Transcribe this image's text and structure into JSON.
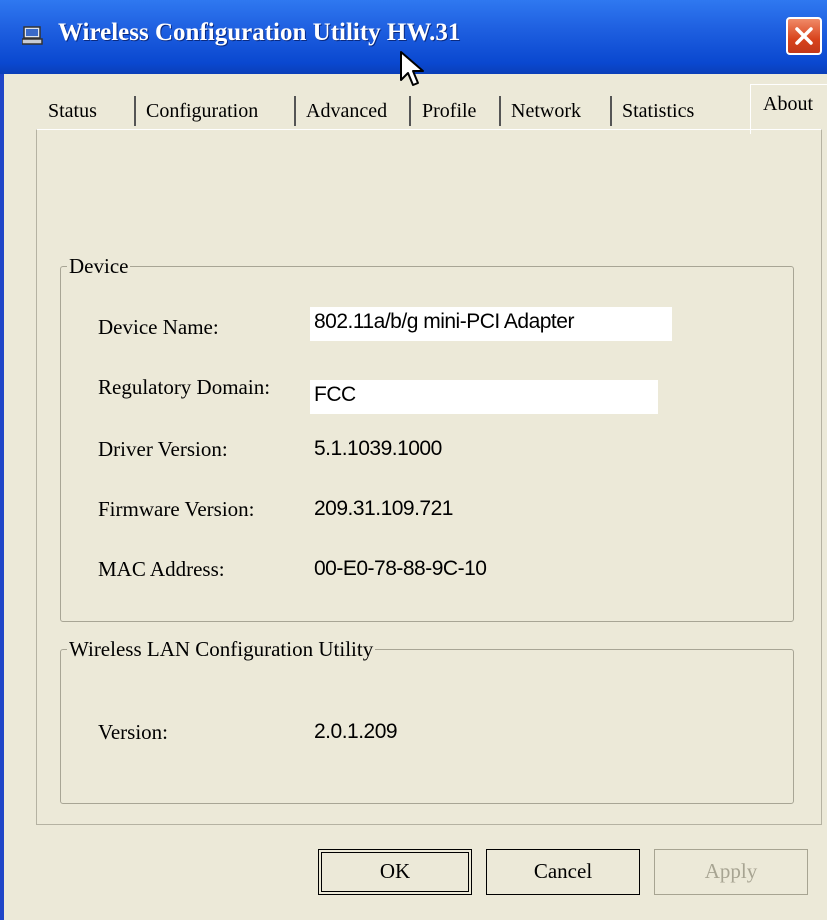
{
  "window": {
    "title": "Wireless Configuration Utility HW.31"
  },
  "tabs": [
    {
      "label": "Status"
    },
    {
      "label": "Configuration"
    },
    {
      "label": "Advanced"
    },
    {
      "label": "Profile"
    },
    {
      "label": "Network"
    },
    {
      "label": "Statistics"
    },
    {
      "label": "About",
      "active": true
    }
  ],
  "device_group": {
    "title": "Device",
    "device_name_label": "Device Name:",
    "device_name_value": "802.11a/b/g mini-PCI Adapter",
    "regulatory_label": "Regulatory Domain:",
    "regulatory_value": "FCC",
    "driver_label": "Driver Version:",
    "driver_value": "5.1.1039.1000",
    "firmware_label": "Firmware Version:",
    "firmware_value": "209.31.109.721",
    "mac_label": "MAC Address:",
    "mac_value": "00-E0-78-88-9C-10"
  },
  "wlan_group": {
    "title": "Wireless LAN Configuration Utility",
    "version_label": "Version:",
    "version_value": "2.0.1.209"
  },
  "buttons": {
    "ok": "OK",
    "cancel": "Cancel",
    "apply": "Apply"
  },
  "icons": {
    "title": "computer-icon",
    "close": "close-icon",
    "cursor": "mouse-cursor-icon"
  },
  "colors": {
    "titlebar": "#0a48d0",
    "close": "#d8431c",
    "face": "#ece9d8"
  }
}
